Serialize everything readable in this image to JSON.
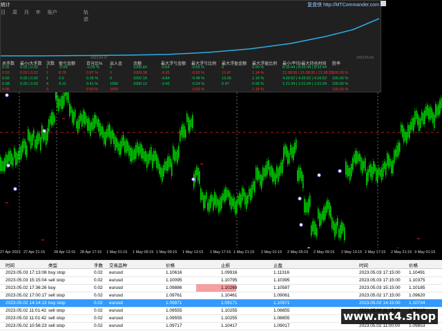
{
  "panel": {
    "title": "统计",
    "title_right": "复盘侠 http://MTCommander.com",
    "menu": [
      "日",
      "周",
      "月",
      "年",
      "账户"
    ],
    "menu_track": "轨迹",
    "date_start": "2023.04.27",
    "date_end": "2023.05.03",
    "headers": [
      "总手数",
      "最小/大手数",
      "次数",
      "盈亏金额",
      "百分比%",
      "出入金",
      "余额",
      "最大浮亏金额",
      "最大浮亏比例",
      "最大浮盈金额",
      "最大浮盈比例",
      "最小/平均/最大持仓时间",
      "胜率"
    ],
    "rows": [
      {
        "color": "#00e05a",
        "cells": [
          "0.02",
          "0.02 | 0.02",
          "1",
          "-0.54",
          "-0.05 %",
          "0",
          "1008.84",
          "-0.64",
          "-0.06 %",
          "0",
          "0.00 %",
          "8:32:44 | 8:32:44 | 8:32:44",
          ""
        ]
      },
      {
        "color": "#ff3030",
        "cells": [
          "0.02",
          "0.02 | 0.02",
          "1",
          "8.76",
          "0.87 %",
          "0",
          "1009.38",
          "-9.35",
          "-0.93 %",
          "11.47",
          "1.14 %",
          "21:38:35 | 21:38:35 | 21:38:35",
          "100.00 %"
        ]
      },
      {
        "color": "#00e05a",
        "cells": [
          "0.02",
          "0.02 | 0.02",
          "1",
          "2.6",
          "0.26 %",
          "0",
          "1002.16",
          "-4.84",
          "-0.48 %",
          "13.26",
          "1.15 %",
          "4:26:52 | 4:26:52 | 4:26:52",
          "100.00 %"
        ]
      },
      {
        "color": "#00e05a",
        "cells": [
          "0.08",
          "0.02 | 0.02",
          "4",
          "4.12",
          "0.41 %",
          "1000",
          "1000.12",
          "-2.42",
          "-0.24 %",
          "5.47",
          "0.55 %",
          "1:21:34 | 1:21:34 | 1:21:34",
          "100.00 %"
        ]
      },
      {
        "color": "#ff3030",
        "cells": [
          "0.06",
          "",
          "3",
          "",
          "0.53 %",
          "1000",
          "",
          "",
          "-0.93 %",
          "",
          "1.14 %",
          "",
          "100.00 %"
        ]
      }
    ]
  },
  "chart": {
    "bull_color": "#00e000",
    "level_color": "#ff2020",
    "x_labels": [
      "27 Apr 2023",
      "27 Apr 21:15",
      "28 Apr 09:15",
      "28 Apr 13:15",
      "28 Apr 17:15",
      "1 May 01:15",
      "1 May 05:15",
      "1 May 09:15",
      "1 May 13:15",
      "1 May 17:15",
      "1 May 21:15",
      "2 May 01:15",
      "2 May 05:15",
      "2 May 09:15",
      "2 May 13:15",
      "2 May 17:15",
      "2 May 21:15",
      "3 May 01:15",
      "3 May 05:15",
      "3 May 09:15",
      "3 May 13:15"
    ]
  },
  "table": {
    "headers": [
      "时间",
      "类型",
      "手数",
      "交易品种",
      "价格",
      "止损",
      "止盈",
      "时间",
      "价格"
    ],
    "rows": [
      [
        "2023.05.03 17:13:08",
        "buy stop",
        "0.02",
        "eurusd",
        "1.10616",
        "1.09916",
        "1.11316",
        "2023.05.03 17:15:00",
        "1.10491"
      ],
      [
        "2023.05.03 15:15:04",
        "sell stop",
        "0.02",
        "eurusd",
        "1.10095",
        "1.10795",
        "1.10395",
        "2023.05.03 17:15:00",
        "1.10375"
      ],
      [
        "2023.05.02 17:36:26",
        "buy",
        "0.02",
        "eurusd",
        "1.09886",
        "1.10269",
        "1.10587",
        "2023.05.03 15:15:00",
        "1.10185"
      ],
      [
        "2023.05.02 17:00:17",
        "sell stop",
        "0.02",
        "eurusd",
        "1.09761",
        "1.10461",
        "1.09061",
        "2023.05.02 17:15:00",
        "1.09620"
      ],
      [
        "2023.05.02 14:14:13",
        "buy stop",
        "0.02",
        "eurusd",
        "1.09871",
        "1.09171",
        "1.10571",
        "2023.05.02 14:15:00",
        "1.10734"
      ],
      [
        "2023.05.02 11:01:42",
        "sell stop",
        "0.02",
        "eurusd",
        "1.09555",
        "1.10255",
        "1.08855",
        "2023.05.02 11:15:00",
        "1.09410"
      ],
      [
        "2023.05.02 11:01:42",
        "sell stop",
        "0.02",
        "eurusd",
        "1.09555",
        "1.10255",
        "1.08855",
        "2023.05.02 11:15:00",
        "1.09410"
      ],
      [
        "2023.05.02 10:56:23",
        "sell stop",
        "0.02",
        "eurusd",
        "1.09717",
        "1.10417",
        "1.09017",
        "2023.05.02 11:00:00",
        "1.09853"
      ]
    ],
    "selected_row": 4,
    "highlight_cell": {
      "row": 2,
      "col": 5,
      "color": "#f4a0a0"
    }
  },
  "watermark": "www.mt4.shop"
}
